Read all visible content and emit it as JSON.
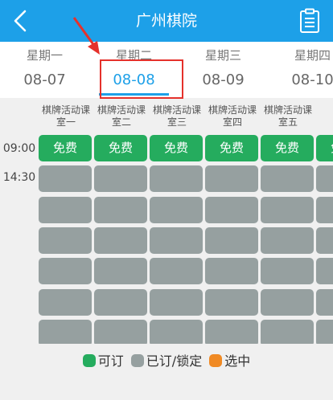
{
  "header": {
    "title": "广州棋院",
    "back_icon": "chevron-left-icon",
    "menu_icon": "clipboard-list-icon",
    "color": "#1da0e8"
  },
  "dates": [
    {
      "weekday": "星期一",
      "date": "08-07"
    },
    {
      "weekday": "星期二",
      "date": "08-08",
      "selected": true
    },
    {
      "weekday": "星期三",
      "date": "08-09"
    },
    {
      "weekday": "星期四",
      "date": "08-10"
    }
  ],
  "rooms": [
    {
      "line1": "棋牌活动课",
      "line2": "室一"
    },
    {
      "line1": "棋牌活动课",
      "line2": "室二"
    },
    {
      "line1": "棋牌活动课",
      "line2": "室三"
    },
    {
      "line1": "棋牌活动课",
      "line2": "室四"
    },
    {
      "line1": "棋牌活动课",
      "line2": "室五"
    }
  ],
  "times": [
    "09:00",
    "14:30"
  ],
  "slots": {
    "free_label": "免费",
    "free_color": "#25ac5e",
    "booked_color": "#96a0a0"
  },
  "legend": [
    {
      "label": "可订",
      "color": "#25ac5e"
    },
    {
      "label": "已订/锁定",
      "color": "#96a0a0"
    },
    {
      "label": "选中",
      "color": "#f08a24"
    }
  ]
}
